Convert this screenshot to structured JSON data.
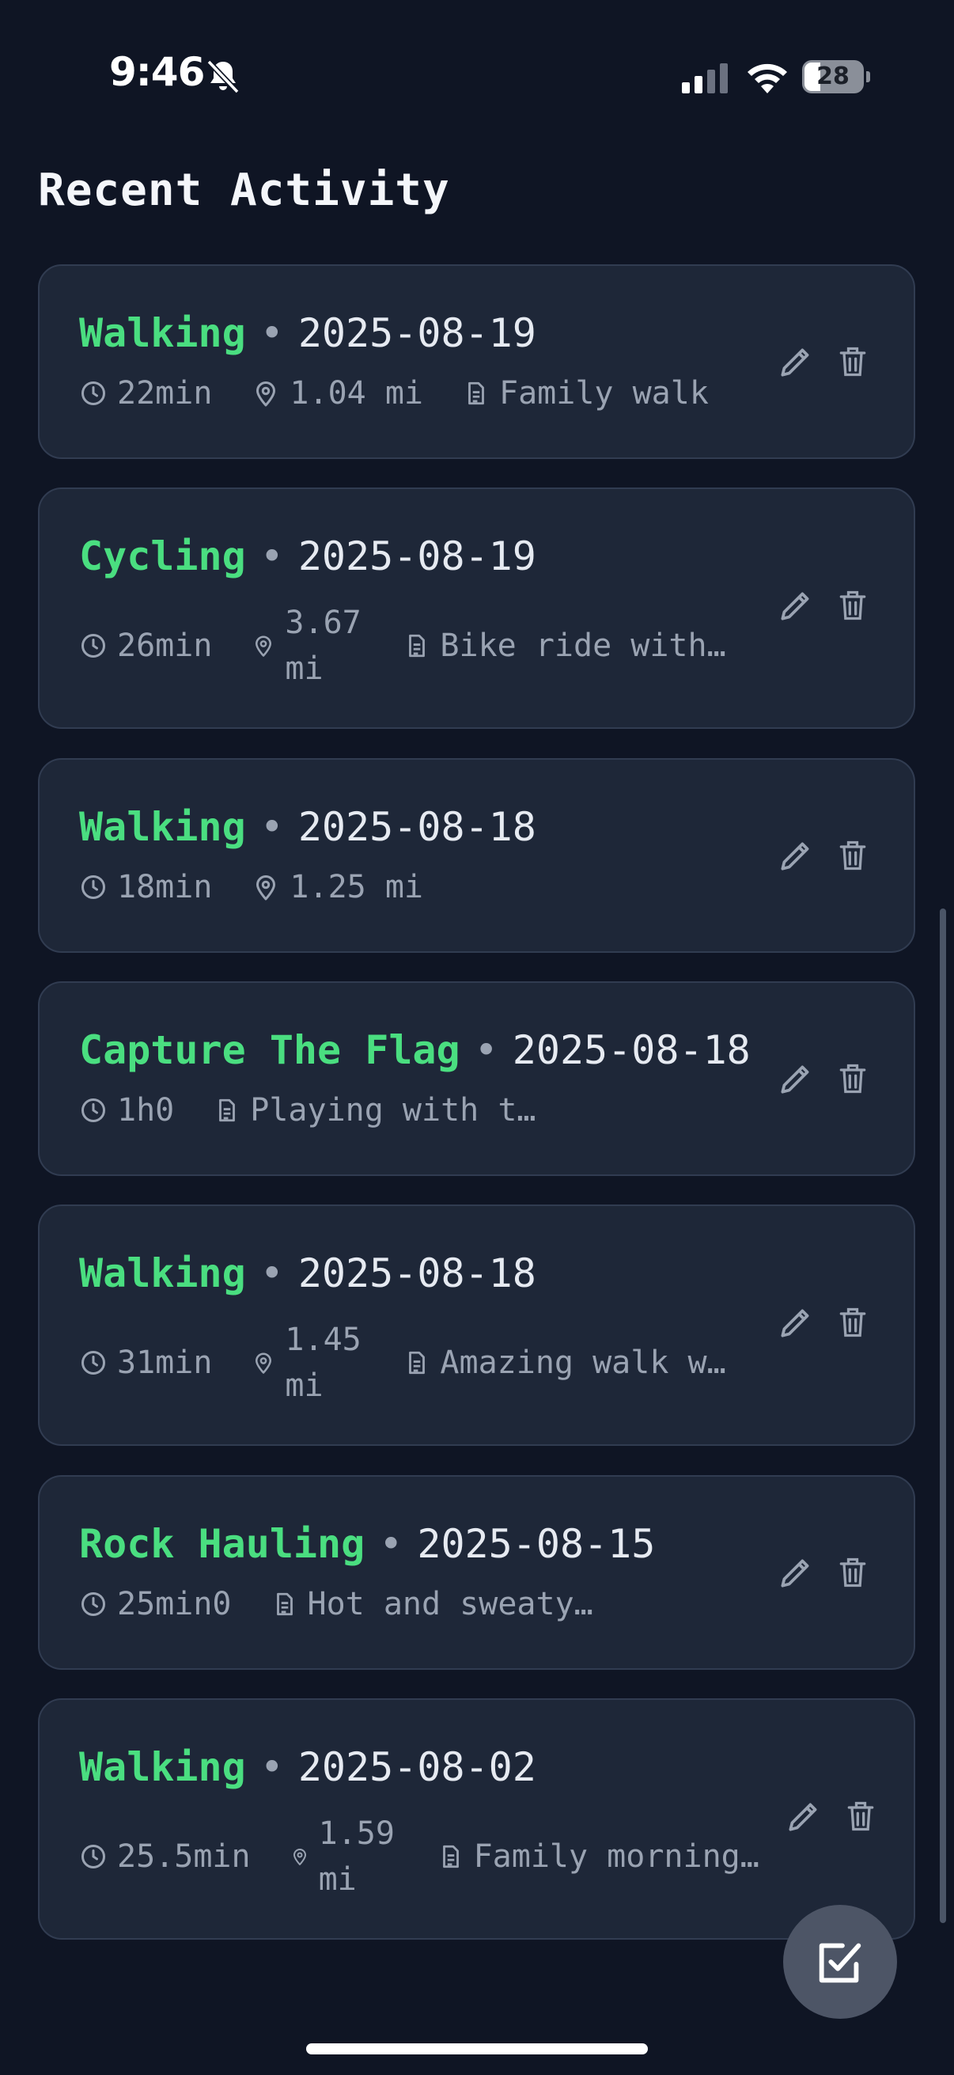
{
  "status_bar": {
    "time": "9:46",
    "battery": "28",
    "battery_level": 0.28,
    "icons": [
      "bell-slash-icon",
      "cellular-signal-icon",
      "wifi-icon",
      "battery-icon"
    ]
  },
  "section_title": "Recent Activity",
  "separator": "•",
  "activities": [
    {
      "type": "Walking",
      "date": "2025-08-19",
      "duration": "22min",
      "distance": "1.04 mi",
      "note": "Family walk"
    },
    {
      "type": "Cycling",
      "date": "2025-08-19",
      "duration": "26min",
      "distance": "3.67 mi",
      "note": "Bike ride with…"
    },
    {
      "type": "Walking",
      "date": "2025-08-18",
      "duration": "18min",
      "distance": "1.25 mi",
      "note": ""
    },
    {
      "type": "Capture The Flag",
      "date": "2025-08-18",
      "duration": "1h0",
      "distance": "",
      "note": "Playing with t…"
    },
    {
      "type": "Walking",
      "date": "2025-08-18",
      "duration": "31min",
      "distance": "1.45 mi",
      "note": "Amazing walk w…"
    },
    {
      "type": "Rock Hauling",
      "date": "2025-08-15",
      "duration": "25min0",
      "distance": "",
      "note": "Hot and sweaty…"
    },
    {
      "type": "Walking",
      "date": "2025-08-02",
      "duration": "25.5min",
      "distance": "1.59 mi",
      "note": "Family morning…"
    }
  ],
  "icons": {
    "duration": "clock-icon",
    "distance": "map-pin-icon",
    "note": "document-icon",
    "edit": "pencil-icon",
    "delete": "trash-icon",
    "fab": "checkbox-edit-icon"
  },
  "colors": {
    "background": "#0f1524",
    "card": "#1e2738",
    "activity_accent": "#4ade80",
    "muted_text": "#9aa3b2"
  }
}
